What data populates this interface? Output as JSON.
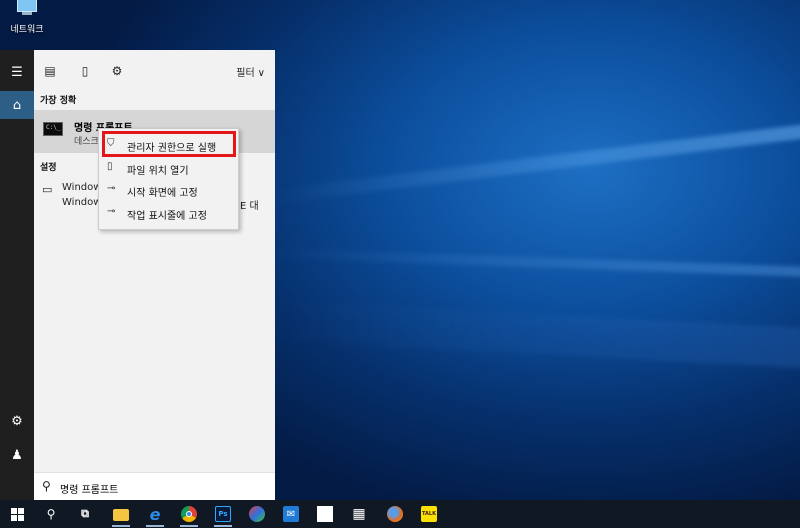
{
  "desktop": {
    "icon_label": "네트워크"
  },
  "start_rail": {
    "items": [
      {
        "name": "hamburger-menu-icon",
        "glyph": "☰"
      },
      {
        "name": "home-icon",
        "glyph": "⌂"
      },
      {
        "name": "settings-icon",
        "glyph": "⚙"
      },
      {
        "name": "user-icon",
        "glyph": "♟"
      }
    ]
  },
  "panel": {
    "filter_label": "필터",
    "best_match_heading": "가장 정확",
    "best_match": {
      "name": "명령 프롬프트",
      "subtitle": "데스크"
    },
    "settings_heading": "설정",
    "setting_item": {
      "line1": "Window",
      "line2": "Window",
      "tail": "E 대"
    },
    "search_query": "명령 프롬프트"
  },
  "context_menu": {
    "items": [
      {
        "label": "관리자 권한으로 실행",
        "icon": "shield-icon",
        "highlighted": true
      },
      {
        "label": "파일 위치 열기",
        "icon": "file-location-icon",
        "highlighted": false
      },
      {
        "label": "시작 화면에 고정",
        "icon": "pin-icon",
        "highlighted": false
      },
      {
        "label": "작업 표시줄에 고정",
        "icon": "pin-icon",
        "highlighted": false
      }
    ],
    "highlight_color": "#e3161a"
  },
  "taskbar": {
    "apps": [
      {
        "name": "search-icon",
        "label": "⚲"
      },
      {
        "name": "task-view-icon",
        "label": "⧉"
      },
      {
        "name": "file-explorer-icon",
        "label": ""
      },
      {
        "name": "edge-icon",
        "label": "e"
      },
      {
        "name": "chrome-icon",
        "label": ""
      },
      {
        "name": "photoshop-icon",
        "label": "Ps"
      },
      {
        "name": "paint-icon",
        "label": ""
      },
      {
        "name": "mail-icon",
        "label": "✉"
      },
      {
        "name": "sticky-notes-icon",
        "label": ""
      },
      {
        "name": "calculator-icon",
        "label": "▦"
      },
      {
        "name": "firefox-icon",
        "label": ""
      },
      {
        "name": "kakaotalk-icon",
        "label": "TALK"
      }
    ]
  }
}
